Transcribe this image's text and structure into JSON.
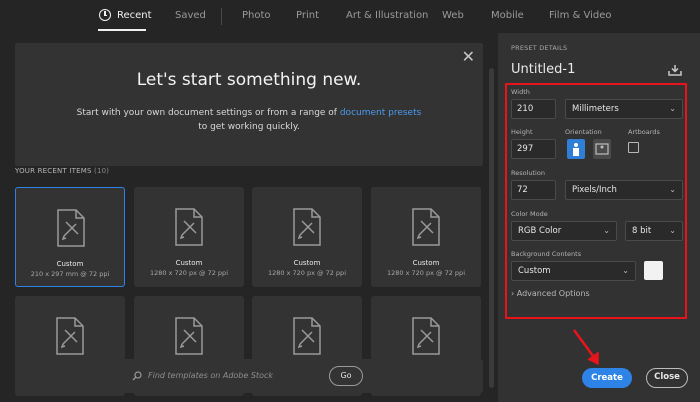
{
  "tabs": [
    {
      "label": "Recent"
    },
    {
      "label": "Saved"
    },
    {
      "label": "Photo"
    },
    {
      "label": "Print"
    },
    {
      "label": "Art & Illustration"
    },
    {
      "label": "Web"
    },
    {
      "label": "Mobile"
    },
    {
      "label": "Film & Video"
    }
  ],
  "hero": {
    "title": "Let's start something new.",
    "subtitle_pre": "Start with your own document settings or from a range of ",
    "subtitle_link": "document presets",
    "subtitle_post": "to get working quickly."
  },
  "recent": {
    "heading": "YOUR RECENT ITEMS",
    "count": "(10)",
    "items": [
      {
        "name": "Custom",
        "meta": "210 x 297 mm @ 72 ppi"
      },
      {
        "name": "Custom",
        "meta": "1280 x 720 px @ 72 ppi"
      },
      {
        "name": "Custom",
        "meta": "1280 x 720 px @ 72 ppi"
      },
      {
        "name": "Custom",
        "meta": "1280 x 720 px @ 72 ppi"
      },
      {
        "name": "",
        "meta": ""
      },
      {
        "name": "",
        "meta": ""
      },
      {
        "name": "",
        "meta": ""
      },
      {
        "name": "",
        "meta": ""
      }
    ]
  },
  "search": {
    "placeholder": "Find templates on Adobe Stock",
    "go_label": "Go"
  },
  "preset": {
    "section_label": "PRESET DETAILS",
    "name": "Untitled-1",
    "width_label": "Width",
    "width_value": "210",
    "width_unit": "Millimeters",
    "height_label": "Height",
    "height_value": "297",
    "orientation_label": "Orientation",
    "artboards_label": "Artboards",
    "resolution_label": "Resolution",
    "resolution_value": "72",
    "resolution_unit": "Pixels/Inch",
    "color_mode_label": "Color Mode",
    "color_mode_value": "RGB Color",
    "bit_depth": "8 bit",
    "background_label": "Background Contents",
    "background_value": "Custom",
    "advanced_label": "Advanced Options"
  },
  "actions": {
    "create": "Create",
    "close": "Close"
  },
  "colors": {
    "accent": "#2d84e6",
    "highlight_box": "#e8141c"
  }
}
